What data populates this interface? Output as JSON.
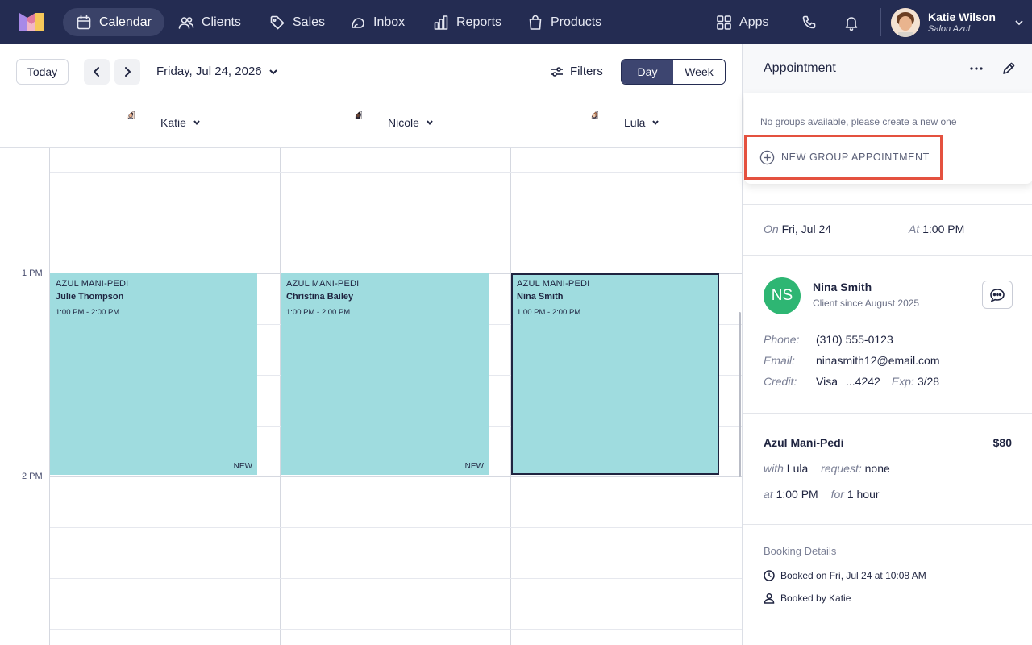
{
  "nav": {
    "items": [
      {
        "label": "Calendar",
        "icon": "calendar-icon",
        "active": true
      },
      {
        "label": "Clients",
        "icon": "users-icon"
      },
      {
        "label": "Sales",
        "icon": "tag-icon"
      },
      {
        "label": "Inbox",
        "icon": "inbox-icon"
      },
      {
        "label": "Reports",
        "icon": "bar-chart-icon"
      },
      {
        "label": "Products",
        "icon": "shopping-bag-icon"
      }
    ],
    "apps_label": "Apps",
    "user": {
      "name": "Katie Wilson",
      "location": "Salon Azul"
    }
  },
  "toolbar": {
    "today_label": "Today",
    "date_label": "Friday, Jul 24, 2026",
    "filters_label": "Filters",
    "view_day": "Day",
    "view_week": "Week",
    "active_view": "Day"
  },
  "staff": [
    {
      "name": "Katie"
    },
    {
      "name": "Nicole"
    },
    {
      "name": "Lula"
    }
  ],
  "time_labels": [
    "1 PM",
    "2 PM"
  ],
  "appointments": [
    {
      "service": "AZUL MANI-PEDI",
      "client": "Julie Thompson",
      "time": "1:00 PM - 2:00 PM",
      "tag": "NEW",
      "staff": "Katie"
    },
    {
      "service": "AZUL MANI-PEDI",
      "client": "Christina Bailey",
      "time": "1:00 PM - 2:00 PM",
      "tag": "NEW",
      "staff": "Nicole"
    },
    {
      "service": "AZUL MANI-PEDI",
      "client": "Nina Smith",
      "time": "1:00 PM - 2:00 PM",
      "tag": "",
      "staff": "Lula",
      "selected": true
    }
  ],
  "panel": {
    "title": "Appointment",
    "no_groups_text": "No groups available, please create a new one",
    "new_group_label": "NEW GROUP APPOINTMENT",
    "on_label": "On",
    "on_value": "Fri, Jul 24",
    "at_label": "At",
    "at_value": "1:00 PM",
    "client": {
      "initials": "NS",
      "name": "Nina Smith",
      "since": "Client since August 2025",
      "phone_label": "Phone:",
      "phone": "(310) 555-0123",
      "email_label": "Email:",
      "email": "ninasmith12@email.com",
      "credit_label": "Credit:",
      "card_brand": "Visa",
      "card_last4": "...4242",
      "exp_label": "Exp:",
      "exp_value": "3/28",
      "avatar_color": "#2eb673"
    },
    "service": {
      "name": "Azul Mani-Pedi",
      "price": "$80",
      "with_label": "with",
      "with_value": "Lula",
      "request_label": "request:",
      "request_value": "none",
      "at_label": "at",
      "at_value": "1:00 PM",
      "for_label": "for",
      "for_value": "1 hour"
    },
    "booking": {
      "title": "Booking Details",
      "booked_on": "Booked on Fri, Jul 24 at 10:08 AM",
      "booked_by": "Booked by Katie"
    }
  },
  "colors": {
    "topbar": "#242c52",
    "appointment": "#9fdcdf",
    "highlight": "#e4513f"
  }
}
